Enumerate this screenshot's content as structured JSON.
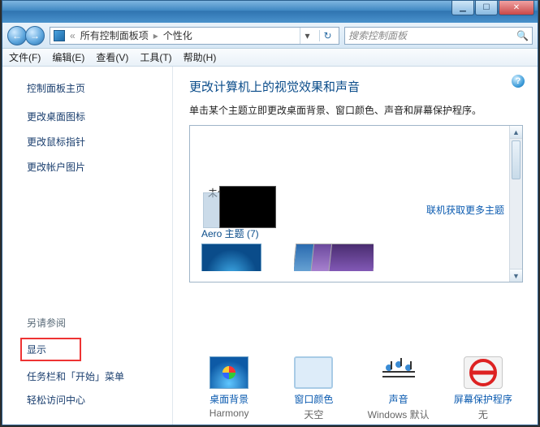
{
  "titlebar": {
    "min": "▁",
    "max": "☐",
    "close": "✕"
  },
  "nav": {
    "back": "←",
    "fwd": "→",
    "crumb_sep": "«",
    "crumb1": "所有控制面板项",
    "crumb2": "个性化",
    "drop": "▾",
    "refresh": "↻",
    "search_placeholder": "搜索控制面板",
    "search_icon": "🔍"
  },
  "menu": {
    "file": "文件(F)",
    "edit": "编辑(E)",
    "view": "查看(V)",
    "tools": "工具(T)",
    "help": "帮助(H)"
  },
  "sidebar": {
    "home": "控制面板主页",
    "links": [
      "更改桌面图标",
      "更改鼠标指针",
      "更改帐户图片"
    ],
    "seealso_label": "另请参阅",
    "seealso": {
      "display": "显示",
      "taskbar": "任务栏和「开始」菜单",
      "ease": "轻松访问中心"
    }
  },
  "content": {
    "help": "?",
    "title": "更改计算机上的视觉效果和声音",
    "sub": "单击某个主题立即更改桌面背景、窗口颜色、声音和屏幕保护程序。",
    "unsaved_theme": "未保存的主题",
    "online_link": "联机获取更多主题",
    "aero_label": "Aero 主题 (7)",
    "scroll_up": "▲",
    "scroll_down": "▼"
  },
  "tiles": {
    "bg": {
      "l1": "桌面背景",
      "l2": "Harmony"
    },
    "color": {
      "l1": "窗口颜色",
      "l2": "天空"
    },
    "sound": {
      "l1": "声音",
      "l2": "Windows 默认"
    },
    "saver": {
      "l1": "屏幕保护程序",
      "l2": "无"
    }
  }
}
